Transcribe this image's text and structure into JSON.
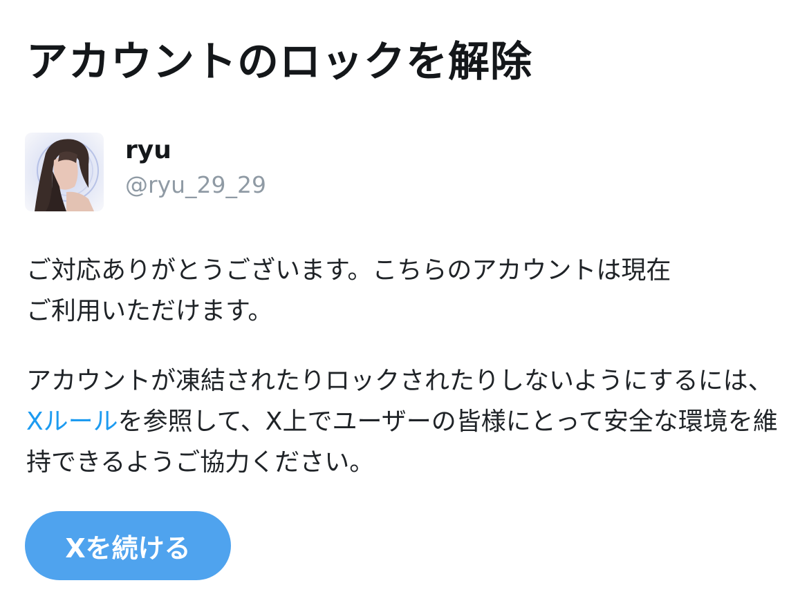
{
  "title": "アカウントのロックを解除",
  "user": {
    "display_name": "ryu",
    "handle": "@ryu_29_29"
  },
  "message": {
    "line1_a": "ご対応ありがとうございます。こちらのアカウントは現在",
    "line1_b": "ご利用いただけます。",
    "para2_prefix": "アカウントが凍結されたりロックされたりしないようにするには、",
    "rules_link": "Xルール",
    "para2_suffix": "を参照して、X上でユーザーの皆様にとって安全な環境を維持できるようご協力ください。"
  },
  "continue_button": {
    "label": "Xを続ける"
  },
  "colors": {
    "link": "#1d9bf0",
    "button": "#4fa3ee",
    "handle": "#8f9aa4"
  }
}
